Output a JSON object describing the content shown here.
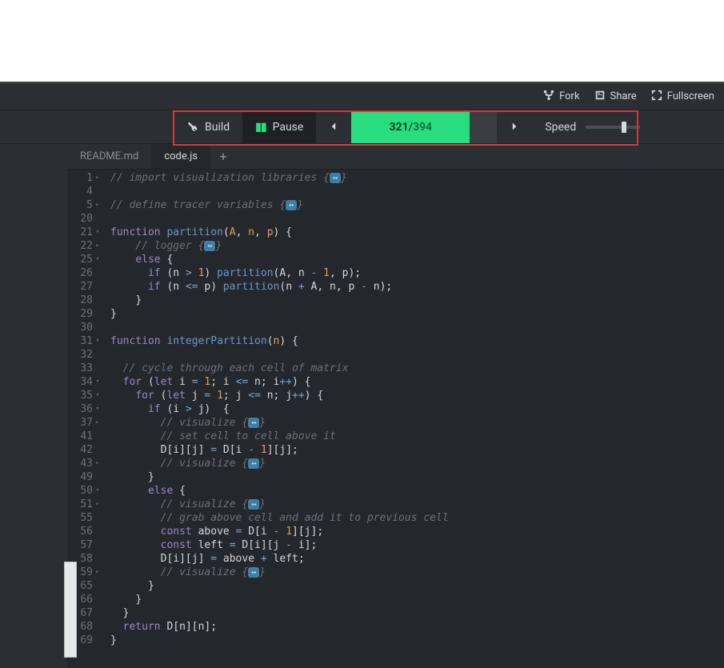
{
  "titlebar": {
    "fork_label": "Fork",
    "share_label": "Share",
    "fullscreen_label": "Fullscreen"
  },
  "toolbar": {
    "build_label": "Build",
    "pause_label": "Pause",
    "progress_current": "321",
    "progress_total": "394",
    "progress_separator": " / ",
    "progress_percent": 81,
    "speed_label": "Speed",
    "speed_thumb_pct": 72
  },
  "tabs": {
    "items": [
      {
        "label": "README.md",
        "active": false
      },
      {
        "label": "code.js",
        "active": true
      }
    ],
    "add_label": "+"
  },
  "editor": {
    "fold_badge": "↔",
    "lines": [
      {
        "n": 1,
        "fold": "▸",
        "html": "<span class='c-comment'>// import visualization libraries {</span><span class='fold-badge'>↔</span><span class='c-comment'>}</span>"
      },
      {
        "n": 4,
        "fold": "",
        "html": ""
      },
      {
        "n": 5,
        "fold": "▸",
        "html": "<span class='c-comment'>// define tracer variables {</span><span class='fold-badge'>↔</span><span class='c-comment'>}</span>"
      },
      {
        "n": 20,
        "fold": "",
        "html": ""
      },
      {
        "n": 21,
        "fold": "▾",
        "html": "<span class='c-kw'>function</span> <span class='c-fn'>partition</span><span class='c-punc'>(</span><span class='c-param'>A</span><span class='c-punc'>, </span><span class='c-param'>n</span><span class='c-punc'>, </span><span class='c-param'>p</span><span class='c-punc'>) {</span>"
      },
      {
        "n": 22,
        "fold": "▸",
        "html": "    <span class='c-comment'>// logger {</span><span class='fold-badge'>↔</span><span class='c-comment'>}</span>"
      },
      {
        "n": 25,
        "fold": "▾",
        "html": "    <span class='c-kw'>else</span> <span class='c-punc'>{</span>"
      },
      {
        "n": 26,
        "fold": "",
        "html": "      <span class='c-kw'>if</span> <span class='c-punc'>(</span><span class='c-var'>n</span> <span class='c-op'>&gt;</span> <span class='c-num'>1</span><span class='c-punc'>)</span> <span class='c-fn'>partition</span><span class='c-punc'>(</span><span class='c-var'>A</span><span class='c-punc'>, </span><span class='c-var'>n</span> <span class='c-op'>-</span> <span class='c-num'>1</span><span class='c-punc'>, </span><span class='c-var'>p</span><span class='c-punc'>);</span>"
      },
      {
        "n": 27,
        "fold": "",
        "html": "      <span class='c-kw'>if</span> <span class='c-punc'>(</span><span class='c-var'>n</span> <span class='c-op'>&lt;=</span> <span class='c-var'>p</span><span class='c-punc'>)</span> <span class='c-fn'>partition</span><span class='c-punc'>(</span><span class='c-var'>n</span> <span class='c-op'>+</span> <span class='c-var'>A</span><span class='c-punc'>, </span><span class='c-var'>n</span><span class='c-punc'>, </span><span class='c-var'>p</span> <span class='c-op'>-</span> <span class='c-var'>n</span><span class='c-punc'>);</span>"
      },
      {
        "n": 28,
        "fold": "",
        "html": "    <span class='c-punc'>}</span>"
      },
      {
        "n": 29,
        "fold": "",
        "html": "<span class='c-punc'>}</span>"
      },
      {
        "n": 30,
        "fold": "",
        "html": ""
      },
      {
        "n": 31,
        "fold": "▾",
        "html": "<span class='c-kw'>function</span> <span class='c-fn'>integerPartition</span><span class='c-punc'>(</span><span class='c-param'>n</span><span class='c-punc'>) {</span>"
      },
      {
        "n": 32,
        "fold": "",
        "html": ""
      },
      {
        "n": 33,
        "fold": "",
        "html": "  <span class='c-comment'>// cycle through each cell of matrix</span>"
      },
      {
        "n": 34,
        "fold": "▾",
        "html": "  <span class='c-kw'>for</span> <span class='c-punc'>(</span><span class='c-kw'>let</span> <span class='c-var'>i</span> <span class='c-op'>=</span> <span class='c-num'>1</span><span class='c-punc'>; </span><span class='c-var'>i</span> <span class='c-op'>&lt;=</span> <span class='c-var'>n</span><span class='c-punc'>; </span><span class='c-var'>i</span><span class='c-op'>++</span><span class='c-punc'>) {</span>"
      },
      {
        "n": 35,
        "fold": "▾",
        "html": "    <span class='c-kw'>for</span> <span class='c-punc'>(</span><span class='c-kw'>let</span> <span class='c-var'>j</span> <span class='c-op'>=</span> <span class='c-num'>1</span><span class='c-punc'>; </span><span class='c-var'>j</span> <span class='c-op'>&lt;=</span> <span class='c-var'>n</span><span class='c-punc'>; </span><span class='c-var'>j</span><span class='c-op'>++</span><span class='c-punc'>) {</span>"
      },
      {
        "n": 36,
        "fold": "▾",
        "html": "      <span class='c-kw'>if</span> <span class='c-punc'>(</span><span class='c-var'>i</span> <span class='c-op'>&gt;</span> <span class='c-var'>j</span><span class='c-punc'>)  {</span>"
      },
      {
        "n": 37,
        "fold": "▸",
        "html": "        <span class='c-comment'>// visualize {</span><span class='fold-badge'>↔</span><span class='c-comment'>}</span>"
      },
      {
        "n": 41,
        "fold": "",
        "html": "        <span class='c-comment'>// set cell to cell above it</span>"
      },
      {
        "n": 42,
        "fold": "",
        "html": "        <span class='c-var'>D</span><span class='c-punc'>[</span><span class='c-var'>i</span><span class='c-punc'>][</span><span class='c-var'>j</span><span class='c-punc'>]</span> <span class='c-op'>=</span> <span class='c-var'>D</span><span class='c-punc'>[</span><span class='c-var'>i</span> <span class='c-op'>-</span> <span class='c-num'>1</span><span class='c-punc'>][</span><span class='c-var'>j</span><span class='c-punc'>];</span>"
      },
      {
        "n": 43,
        "fold": "▸",
        "hl": true,
        "html": "        <span class='c-comment'>// visualize {</span><span class='fold-badge'>↔</span><span class='c-comment'>}</span>"
      },
      {
        "n": 49,
        "fold": "",
        "html": "      <span class='c-punc'>}</span>"
      },
      {
        "n": 50,
        "fold": "▾",
        "html": "      <span class='c-kw'>else</span> <span class='c-punc'>{</span>"
      },
      {
        "n": 51,
        "fold": "▸",
        "html": "        <span class='c-comment'>// visualize {</span><span class='fold-badge'>↔</span><span class='c-comment'>}</span>"
      },
      {
        "n": 55,
        "fold": "",
        "html": "        <span class='c-comment'>// grab above cell and add it to previous cell</span>"
      },
      {
        "n": 56,
        "fold": "",
        "html": "        <span class='c-kw'>const</span> <span class='c-var'>above</span> <span class='c-op'>=</span> <span class='c-var'>D</span><span class='c-punc'>[</span><span class='c-var'>i</span> <span class='c-op'>-</span> <span class='c-num'>1</span><span class='c-punc'>][</span><span class='c-var'>j</span><span class='c-punc'>];</span>"
      },
      {
        "n": 57,
        "fold": "",
        "html": "        <span class='c-kw'>const</span> <span class='c-var'>left</span> <span class='c-op'>=</span> <span class='c-var'>D</span><span class='c-punc'>[</span><span class='c-var'>i</span><span class='c-punc'>][</span><span class='c-var'>j</span> <span class='c-op'>-</span> <span class='c-var'>i</span><span class='c-punc'>];</span>"
      },
      {
        "n": 58,
        "fold": "",
        "html": "        <span class='c-var'>D</span><span class='c-punc'>[</span><span class='c-var'>i</span><span class='c-punc'>][</span><span class='c-var'>j</span><span class='c-punc'>]</span> <span class='c-op'>=</span> <span class='c-var'>above</span> <span class='c-op'>+</span> <span class='c-var'>left</span><span class='c-punc'>;</span>"
      },
      {
        "n": 59,
        "fold": "▸",
        "html": "        <span class='c-comment'>// visualize {</span><span class='fold-badge'>↔</span><span class='c-comment'>}</span>"
      },
      {
        "n": 65,
        "fold": "",
        "html": "      <span class='c-punc'>}</span>"
      },
      {
        "n": 66,
        "fold": "",
        "html": "    <span class='c-punc'>}</span>"
      },
      {
        "n": 67,
        "fold": "",
        "html": "  <span class='c-punc'>}</span>"
      },
      {
        "n": 68,
        "fold": "",
        "html": "  <span class='c-kw'>return</span> <span class='c-var'>D</span><span class='c-punc'>[</span><span class='c-var'>n</span><span class='c-punc'>][</span><span class='c-var'>n</span><span class='c-punc'>];</span>"
      },
      {
        "n": 69,
        "fold": "",
        "html": "<span class='c-punc'>}</span>"
      }
    ]
  },
  "colors": {
    "accent_green": "#27dd7d",
    "highlight_blue": "#2f5b7a",
    "annotation_red": "#d23b3b"
  }
}
